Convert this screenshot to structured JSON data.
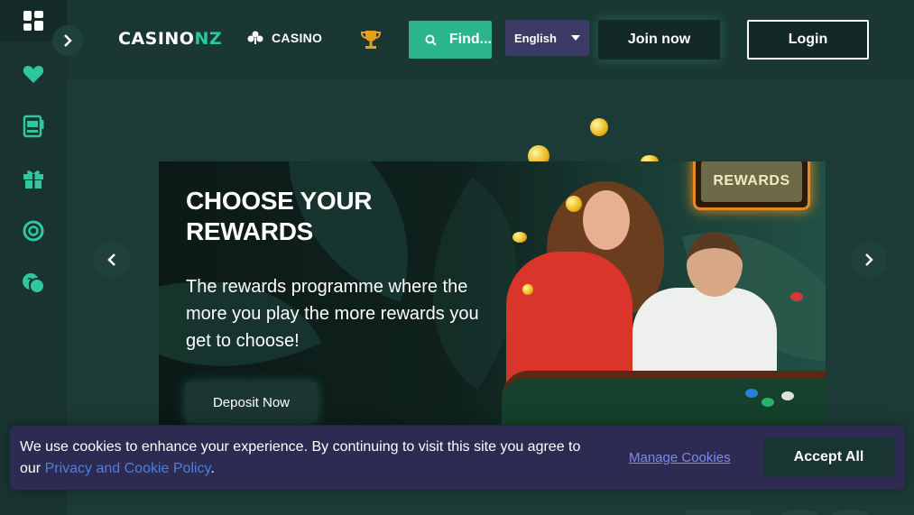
{
  "header": {
    "logo": {
      "part1": "CASINO",
      "part2": "NZ"
    },
    "casino_link": "CASINO",
    "search_label": "Find...",
    "language": "English",
    "join_label": "Join now",
    "login_label": "Login"
  },
  "sidebar": {
    "icons": [
      "grid-icon",
      "heart-icon",
      "slot-machine-icon",
      "gift-icon",
      "lifebuoy-icon",
      "support-chat-icon"
    ]
  },
  "banner": {
    "title": "CHOOSE YOUR REWARDS",
    "text": "The rewards programme where the more you play the more rewards you get to choose!",
    "button_label": "Deposit Now",
    "badge": "REWARDS"
  },
  "cookie_bar": {
    "text_prefix": "We use cookies to enhance your experience. By continuing to visit this site you agree to our ",
    "policy_link": "Privacy and Cookie Policy",
    "text_suffix": ".",
    "manage_label": "Manage Cookies",
    "accept_label": "Accept All"
  },
  "colors": {
    "accent": "#2ab58d",
    "background": "#1c3a36",
    "cookie_bg": "#2e2b52",
    "lang_bg": "#3c3b66"
  }
}
